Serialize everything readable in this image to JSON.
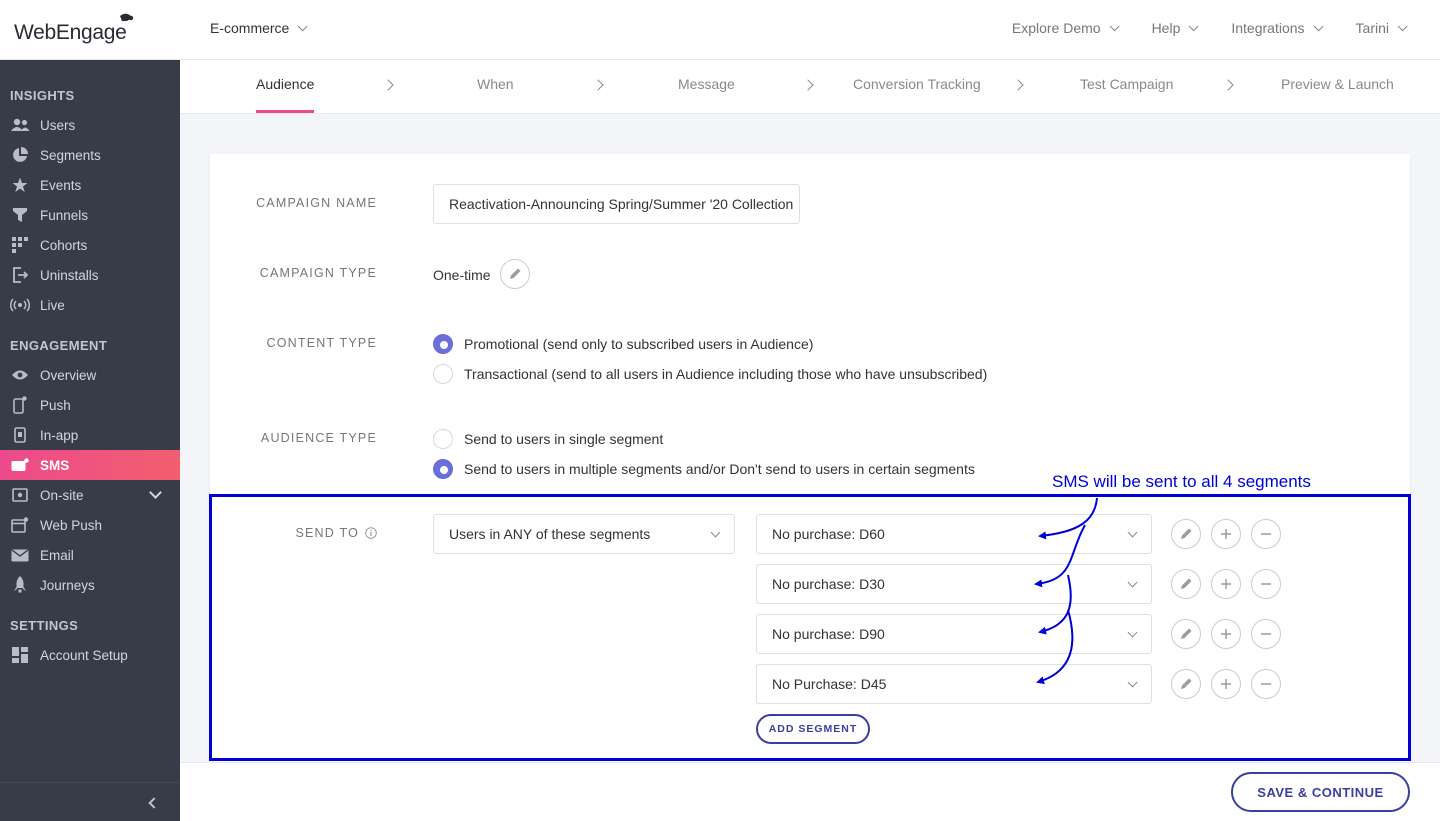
{
  "app": {
    "logo_text": "WebEngage",
    "project": "E-commerce"
  },
  "topnav": {
    "explore_demo": "Explore Demo",
    "help": "Help",
    "integrations": "Integrations",
    "user": "Tarini"
  },
  "sidebar": {
    "insights_title": "INSIGHTS",
    "engagement_title": "ENGAGEMENT",
    "settings_title": "SETTINGS",
    "items": {
      "users": "Users",
      "segments": "Segments",
      "events": "Events",
      "funnels": "Funnels",
      "cohorts": "Cohorts",
      "uninstalls": "Uninstalls",
      "live": "Live",
      "overview": "Overview",
      "push": "Push",
      "inapp": "In-app",
      "sms": "SMS",
      "onsite": "On-site",
      "webpush": "Web Push",
      "email": "Email",
      "journeys": "Journeys",
      "account_setup": "Account Setup"
    }
  },
  "steps": {
    "audience": "Audience",
    "when": "When",
    "message": "Message",
    "conversion": "Conversion Tracking",
    "test": "Test Campaign",
    "preview": "Preview & Launch"
  },
  "form": {
    "campaign_name_label": "CAMPAIGN NAME",
    "campaign_name_value": "Reactivation-Announcing Spring/Summer '20 Collection",
    "campaign_type_label": "CAMPAIGN TYPE",
    "campaign_type_value": "One-time",
    "content_type_label": "CONTENT TYPE",
    "content_promotional": "Promotional (send only to subscribed users in Audience)",
    "content_transactional": "Transactional (send to all users in Audience including those who have unsubscribed)",
    "audience_type_label": "AUDIENCE TYPE",
    "audience_single": "Send to users in single segment",
    "audience_multiple": "Send to users in multiple segments and/or Don't send to users in certain segments",
    "send_to_label": "SEND TO",
    "send_to_value": "Users in ANY of these segments",
    "segments": [
      "No purchase: D60",
      "No purchase: D30",
      "No purchase: D90",
      "No Purchase: D45"
    ],
    "add_segment": "ADD SEGMENT"
  },
  "annotation": {
    "text": "SMS will be sent to all 4 segments"
  },
  "footer": {
    "save_continue": "SAVE & CONTINUE"
  },
  "colors": {
    "accent_pink": "#ec4a8c",
    "primary_blue": "#3a3f9e",
    "radio_purple": "#6a6fd9",
    "annotation_blue": "#0000d6",
    "sidebar_bg": "#383b48"
  }
}
